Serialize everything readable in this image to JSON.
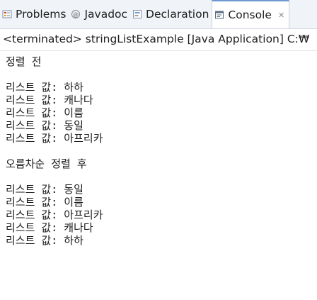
{
  "tabs": [
    {
      "label": "Problems",
      "icon": "problems-icon",
      "active": false
    },
    {
      "label": "Javadoc",
      "icon": "javadoc-icon",
      "active": false
    },
    {
      "label": "Declaration",
      "icon": "declaration-icon",
      "active": false
    },
    {
      "label": "Console",
      "icon": "console-icon",
      "active": true
    }
  ],
  "status_line": "<terminated> stringListExample [Java Application] C:₩",
  "console_lines": [
    "정렬 전",
    "",
    "리스트 값: 하하",
    "리스트 값: 캐나다",
    "리스트 값: 이름",
    "리스트 값: 동일",
    "리스트 값: 아프리카",
    "",
    "오름차순 정렬 후",
    "",
    "리스트 값: 동일",
    "리스트 값: 이름",
    "리스트 값: 아프리카",
    "리스트 값: 캐나다",
    "리스트 값: 하하"
  ],
  "colors": {
    "tab_accent": "#6f99d3",
    "tab_bg": "#f0f3f7"
  }
}
